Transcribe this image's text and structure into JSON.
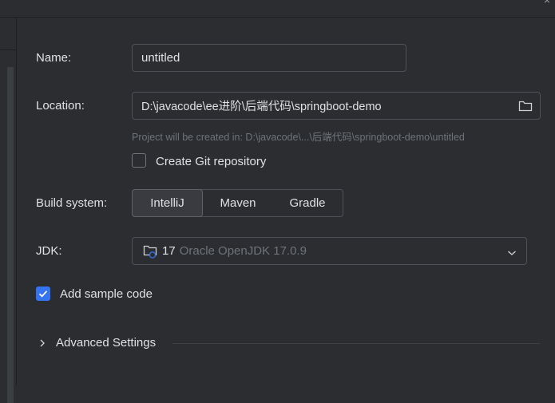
{
  "window": {
    "close_glyph": "×"
  },
  "form": {
    "name": {
      "label": "Name:",
      "value": "untitled"
    },
    "location": {
      "label": "Location:",
      "value": "D:\\javacode\\ee进阶\\后端代码\\springboot-demo",
      "hint": "Project will be created in: D:\\javacode\\...\\后端代码\\springboot-demo\\untitled",
      "browse_icon": "folder-icon"
    },
    "git": {
      "label": "Create Git repository",
      "checked": false
    },
    "build_system": {
      "label": "Build system:",
      "options": [
        "IntelliJ",
        "Maven",
        "Gradle"
      ],
      "selected": "IntelliJ"
    },
    "jdk": {
      "label": "JDK:",
      "version": "17",
      "name": "Oracle OpenJDK 17.0.9",
      "icon": "jdk-folder-icon"
    },
    "sample_code": {
      "label": "Add sample code",
      "checked": true
    },
    "advanced": {
      "label": "Advanced Settings",
      "expanded": false
    }
  },
  "colors": {
    "accent": "#3574f0",
    "background": "#2b2d30",
    "border": "#4e5157",
    "muted": "#6f737a"
  }
}
